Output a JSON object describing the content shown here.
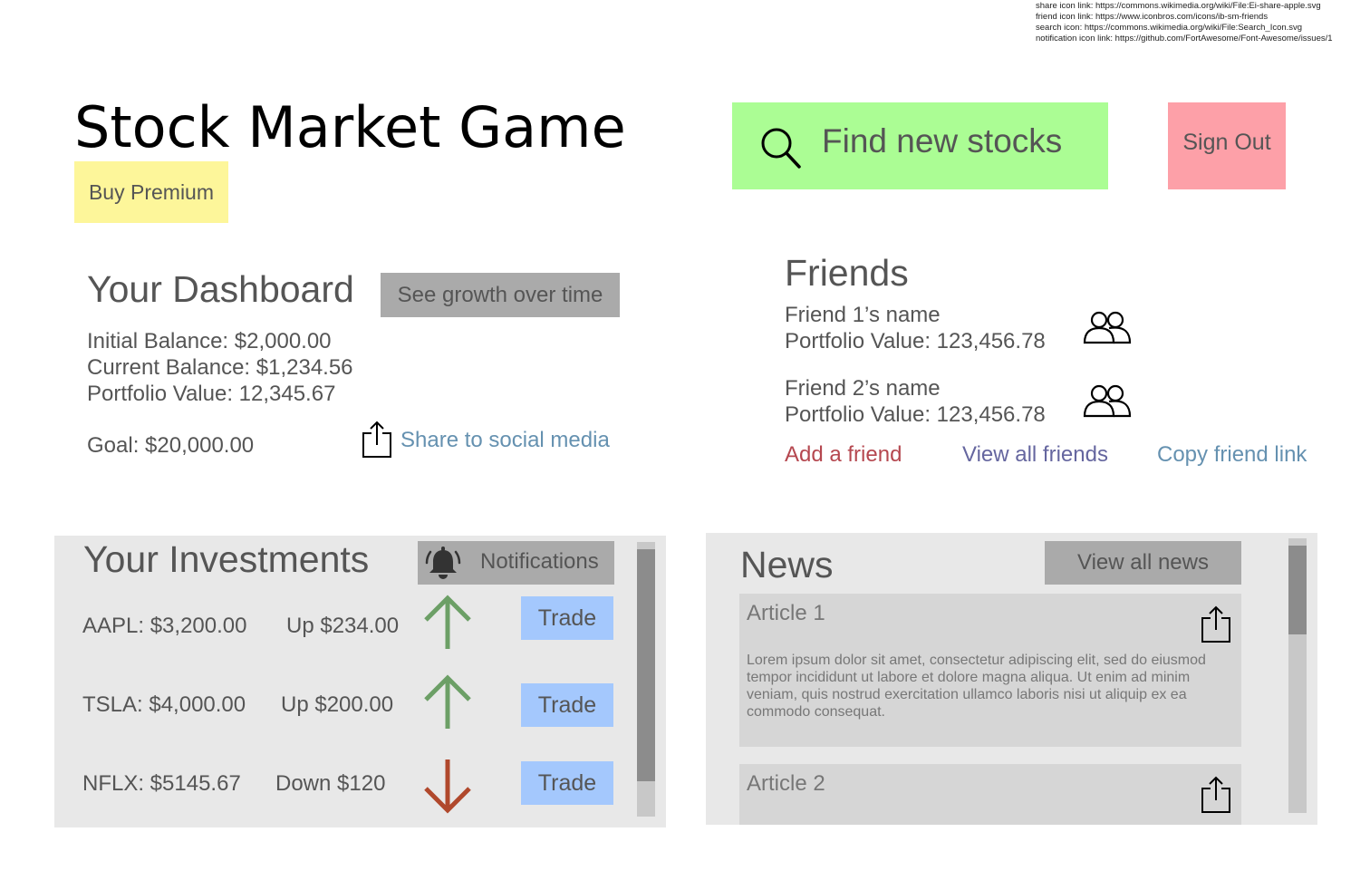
{
  "credits": [
    "share icon link: https://commons.wikimedia.org/wiki/File:Ei-share-apple.svg",
    "friend icon link: https://www.iconbros.com/icons/ib-sm-friends",
    "search icon: https://commons.wikimedia.org/wiki/File:Search_Icon.svg",
    "notification icon link: https://github.com/FortAwesome/Font-Awesome/issues/1"
  ],
  "header": {
    "title": "Stock Market Game",
    "buy_premium": "Buy Premium",
    "search_label": "Find new stocks",
    "sign_out": "Sign Out"
  },
  "dashboard": {
    "title": "Your Dashboard",
    "growth_button": "See growth over time",
    "initial_balance": "Initial Balance: $2,000.00",
    "current_balance": "Current Balance:  $1,234.56",
    "portfolio_value": "Portfolio Value: 12,345.67",
    "goal": "Goal:  $20,000.00",
    "share_label": "Share to social media"
  },
  "friends": {
    "title": "Friends",
    "items": [
      {
        "name": "Friend 1’s name",
        "portfolio": "Portfolio Value: 123,456.78"
      },
      {
        "name": "Friend 2’s name",
        "portfolio": "Portfolio Value: 123,456.78"
      }
    ],
    "add_friend": "Add a friend",
    "view_all": "View all friends",
    "copy_link": "Copy friend link"
  },
  "investments": {
    "title": "Your Investments",
    "notifications_label": "Notifications",
    "trade_label": "Trade",
    "items": [
      {
        "ticker": "AAPL: $3,200.00",
        "change": "Up $234.00",
        "direction": "up"
      },
      {
        "ticker": "TSLA: $4,000.00",
        "change": "Up $200.00",
        "direction": "up"
      },
      {
        "ticker": "NFLX: $5145.67",
        "change": "Down $120",
        "direction": "down"
      }
    ]
  },
  "news": {
    "title": "News",
    "view_all": "View all news",
    "articles": [
      {
        "title": "Article 1",
        "body": "Lorem ipsum dolor sit amet, consectetur adipiscing elit, sed do eiusmod tempor incididunt ut labore et dolore magna aliqua. Ut enim ad minim veniam, quis nostrud exercitation ullamco laboris nisi ut aliquip ex ea commodo consequat."
      },
      {
        "title": "Article 2"
      }
    ]
  },
  "colors": {
    "buy_premium_bg": "#fdf69a",
    "search_bg": "#abfd94",
    "sign_out_bg": "#fda0a8",
    "trade_bg": "#a4c8fd",
    "up_arrow": "#6c9f66",
    "down_arrow": "#b0482c",
    "add_friend": "#b5474f",
    "view_all_friends": "#65669f",
    "copy_link": "#6591b0"
  }
}
